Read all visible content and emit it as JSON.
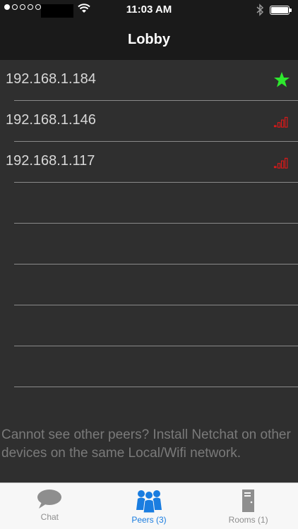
{
  "status_bar": {
    "time": "11:03 AM"
  },
  "nav": {
    "title": "Lobby"
  },
  "peers": [
    {
      "ip": "192.168.1.184",
      "status_icon": "star-icon",
      "status_color": "#2ee82e"
    },
    {
      "ip": "192.168.1.146",
      "status_icon": "signal-strength-icon",
      "status_color": "#e01818"
    },
    {
      "ip": "192.168.1.117",
      "status_icon": "signal-strength-icon",
      "status_color": "#e01818"
    }
  ],
  "hint": "Cannot see other peers? Install Netchat on other devices on the same Local/Wifi network.",
  "tabs": [
    {
      "label": "Chat",
      "icon": "chat-bubble-icon",
      "active": false
    },
    {
      "label": "Peers (3)",
      "icon": "people-icon",
      "active": true
    },
    {
      "label": "Rooms (1)",
      "icon": "door-icon",
      "active": false
    }
  ],
  "colors": {
    "accent": "#1a7de0",
    "background": "#2f2f2f",
    "bar": "#1a1a1a"
  }
}
